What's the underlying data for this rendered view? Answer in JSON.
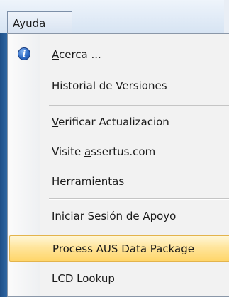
{
  "menubar": {
    "menu_title": "Ayuda",
    "menu_title_access_key": "A",
    "menu_title_rest": "yuda"
  },
  "menu": {
    "items": [
      {
        "label": "Acerca ...",
        "icon": "help-info-icon",
        "key_char": "A",
        "rest": "cerca ..."
      },
      {
        "label": "Historial de Versiones"
      },
      {
        "label": "Verificar Actualizacion",
        "key_char": "V",
        "rest": "erificar Actualizacion"
      },
      {
        "label": "Visite assertus.com",
        "pre": "Visite ",
        "key_char": "a",
        "rest": "ssertus.com"
      },
      {
        "label": "Herramientas",
        "key_char": "H",
        "rest": "erramientas"
      },
      {
        "label": "Iniciar Sesión de Apoyo"
      },
      {
        "label": "Process AUS Data Package",
        "highlighted": true
      },
      {
        "label": "LCD Lookup"
      }
    ]
  },
  "colors": {
    "highlight_top": "#fff7d8",
    "highlight_bottom": "#ffd66a",
    "highlight_border": "#e3b44c",
    "menu_bg": "#f2f2f2",
    "frame_blue": "#2f67a3"
  }
}
